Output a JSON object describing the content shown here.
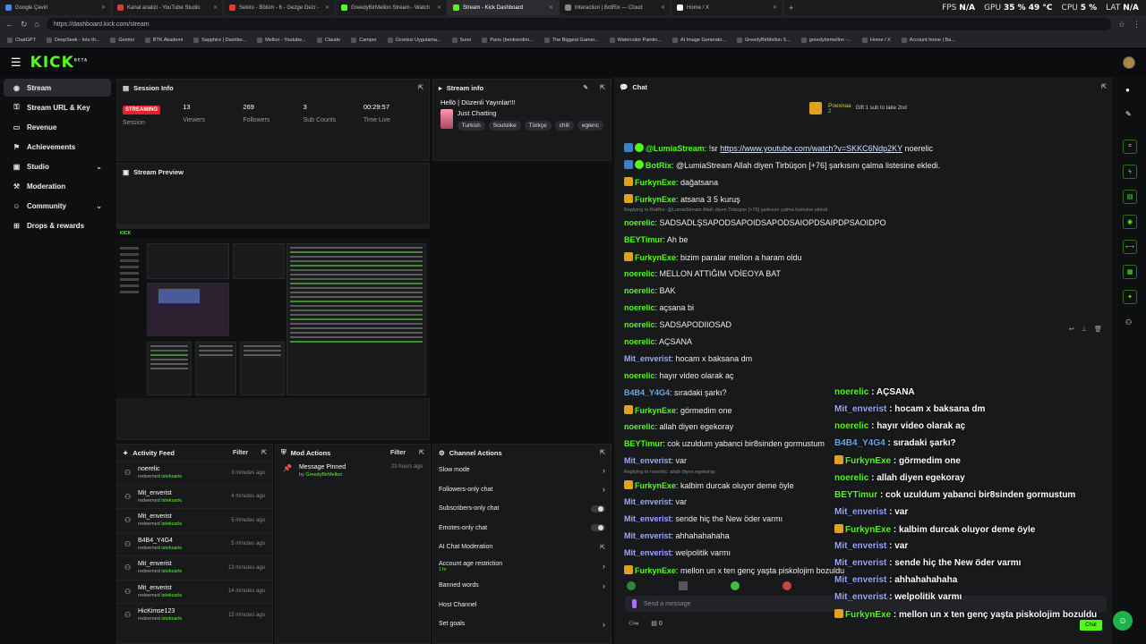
{
  "browser": {
    "tabs": [
      {
        "label": "Google Çeviri",
        "color": "#4a8af4"
      },
      {
        "label": "Kanal analizi - YouTube Studio",
        "color": "#e33"
      },
      {
        "label": "Sekiro - Bölüm - 6 - Gezge Gezr - ",
        "color": "#e33"
      },
      {
        "label": "GreedyBirMellon Stream - Watch",
        "color": "#53fc18"
      },
      {
        "label": "Stream - Kick Dashboard",
        "color": "#53fc18"
      },
      {
        "label": "Interaction | BotRix — Cloud",
        "color": "#888"
      },
      {
        "label": "Home / X",
        "color": "#fff"
      }
    ],
    "url": "https://dashboard.kick.com/stream",
    "stats": {
      "fps_label": "FPS",
      "fps": "N/A",
      "gpu_label": "GPU",
      "gpu": "35 % 49 °C",
      "cpu_label": "CPU",
      "cpu": "5 %",
      "lat_label": "LAT",
      "lat": "N/A"
    },
    "bookmarks": [
      "ChatGPT",
      "DeepSeek - Into th...",
      "Gemini",
      "BTK Akademi",
      "Sapphire | Dashbo...",
      "Mellon - Youtube...",
      "Claude",
      "Camper",
      "Ücretsiz Uygulama...",
      "Suno",
      "Pano (bentrendim...",
      "The Biggest Gamer...",
      "Watercolor Paintin...",
      "AI Image Generato...",
      "GreedyBirMellon S...",
      "greedybirmellon -...",
      "Home / X",
      "Account home | Ba..."
    ]
  },
  "brand": {
    "logo": "KICK",
    "beta": "BETA",
    "accent": "#53fc18"
  },
  "sidebar": {
    "items": [
      {
        "label": "Stream",
        "icon": "broadcast-icon",
        "glyph": "◉",
        "active": true
      },
      {
        "label": "Stream URL & Key",
        "icon": "key-icon",
        "glyph": "⚿"
      },
      {
        "label": "Revenue",
        "icon": "money-icon",
        "glyph": "▭"
      },
      {
        "label": "Achievements",
        "icon": "trophy-icon",
        "glyph": "⚑"
      },
      {
        "label": "Studio",
        "icon": "studio-icon",
        "glyph": "▣",
        "expandable": true
      },
      {
        "label": "Moderation",
        "icon": "gavel-icon",
        "glyph": "⚒"
      },
      {
        "label": "Community",
        "icon": "people-icon",
        "glyph": "☺",
        "expandable": true
      },
      {
        "label": "Drops & rewards",
        "icon": "gift-icon",
        "glyph": "⊞"
      }
    ]
  },
  "session": {
    "title": "Session Info",
    "status": "STREAMING",
    "status_label": "Session",
    "viewers": "13",
    "viewers_label": "Viewers",
    "followers": "269",
    "followers_label": "Followers",
    "subs": "3",
    "subs_label": "Sub Counts",
    "time": "00:29:57",
    "time_label": "Time Live"
  },
  "stream_info": {
    "title": "Stream info",
    "stream_title": "Hellö | Düzenli Yayınlar!!!",
    "category": "Just Chatting",
    "tags": [
      "Turkish",
      "Soulslike",
      "Türkçe",
      "chill",
      "eglenc"
    ]
  },
  "preview": {
    "title": "Stream Preview"
  },
  "activity": {
    "title": "Activity Feed",
    "filter": "Filter",
    "items": [
      {
        "user": "noerelic",
        "action": "redeemed",
        "reward": "isteksarkı",
        "time": "3 minutes ago"
      },
      {
        "user": "Mit_enverist",
        "action": "redeemed",
        "reward": "isteksarkı",
        "time": "4 minutes ago"
      },
      {
        "user": "Mit_enverist",
        "action": "redeemed",
        "reward": "isteksarkı",
        "time": "5 minutes ago"
      },
      {
        "user": "B4B4_Y4G4",
        "action": "redeemed",
        "reward": "isteksarkı",
        "time": "5 minutes ago"
      },
      {
        "user": "Mit_enverist",
        "action": "redeemed",
        "reward": "isteksarkı",
        "time": "13 minutes ago"
      },
      {
        "user": "Mit_enverist",
        "action": "redeemed",
        "reward": "isteksarkı",
        "time": "14 minutes ago"
      },
      {
        "user": "HicKimse123",
        "action": "redeemed",
        "reward": "isteksarkı",
        "time": "15 minutes ago"
      }
    ]
  },
  "mod_actions": {
    "title": "Mod Actions",
    "filter": "Filter",
    "item": {
      "label": "Message Pinned",
      "by": "by",
      "user": "GreedyBirMellon",
      "time": "23 hours ago"
    }
  },
  "channel_actions": {
    "title": "Channel Actions",
    "rows": [
      {
        "label": "Slow mode",
        "kind": "arrow"
      },
      {
        "label": "Followers-only chat",
        "kind": "arrow"
      },
      {
        "label": "Subscribers-only chat",
        "kind": "toggle"
      },
      {
        "label": "Emotes-only chat",
        "kind": "toggle"
      },
      {
        "label": "AI Chat Moderation",
        "kind": "ext"
      },
      {
        "label": "Account age restriction",
        "sub": "1 hr",
        "kind": "arrow"
      },
      {
        "label": "Banned words",
        "kind": "arrow"
      },
      {
        "label": "Host Channel",
        "kind": "none"
      },
      {
        "label": "Set goals",
        "kind": "arrow"
      }
    ]
  },
  "chat": {
    "title": "Chat",
    "top_user": "Poexnaa",
    "top_count": "2",
    "gift_hint": "Gift 1 sub to take 2nd",
    "input_placeholder": "Send a message",
    "footer_count": "0",
    "chat_button": "Chat",
    "messages": [
      {
        "user": "@LumiaStream",
        "color": "#53fc18",
        "badge": "bot",
        "text": ": !sr ",
        "link": "https://www.youtube.com/watch?v=SKKC6Ndp2KY",
        "after": " noerelic"
      },
      {
        "user": "BotRix",
        "color": "#53fc18",
        "badge": "bot",
        "text": ": @LumiaStream Allah diyen Tirbüşon [+76] şarkısını çalma listesine ekledi."
      },
      {
        "user": "FurkynExe",
        "color": "#53fc18",
        "badge": "crown",
        "text": ": dağatsana"
      },
      {
        "user": "FurkynExe",
        "color": "#53fc18",
        "badge": "crown",
        "text": ": atsana 3 5 kuruş"
      },
      {
        "reply": "Replying to BotRix: @LumiaStream Allah diyen Tirbüşon [+76] şarkısını çalma listesine ekledi."
      },
      {
        "user": "noerelic",
        "color": "#53fc18",
        "text": ": SADSADLŞSAPODSAPOIDSAPODSAIOPDSAIPDPSAOIDPO"
      },
      {
        "user": "BEYTimur",
        "color": "#53fc18",
        "text": ": Ah be"
      },
      {
        "user": "FurkynExe",
        "color": "#53fc18",
        "badge": "crown",
        "text": ": bizim paralar mellon a haram oldu"
      },
      {
        "user": "noerelic",
        "color": "#53fc18",
        "text": ": MELLON ATTIĞIM VDİEOYA BAT"
      },
      {
        "user": "noerelic",
        "color": "#53fc18",
        "text": ": BAK"
      },
      {
        "user": "noerelic",
        "color": "#53fc18",
        "text": ": açsana bi"
      },
      {
        "user": "noerelic",
        "color": "#53fc18",
        "text": ": SADSAPODIIOSAD"
      },
      {
        "user": "noerelic",
        "color": "#53fc18",
        "text": ": AÇSANA"
      },
      {
        "user": "Mit_enverist",
        "color": "#9aa7ff",
        "text": ": hocam x baksana dm"
      },
      {
        "user": "noerelic",
        "color": "#53fc18",
        "text": ": hayır video olarak aç"
      },
      {
        "user": "B4B4_Y4G4",
        "color": "#6aa7e8",
        "text": ": sıradaki şarkı?"
      },
      {
        "user": "FurkynExe",
        "color": "#53fc18",
        "badge": "crown",
        "text": ": görmedim one"
      },
      {
        "user": "noerelic",
        "color": "#53fc18",
        "text": ": allah diyen egekoray"
      },
      {
        "user": "BEYTimur",
        "color": "#53fc18",
        "text": ": cok uzuldum yabanci bir8sinden gormustum"
      },
      {
        "user": "Mit_enverist",
        "color": "#9aa7ff",
        "text": ": var"
      },
      {
        "reply": "Replying to noerelic: allah diyen egekoray"
      },
      {
        "user": "FurkynExe",
        "color": "#53fc18",
        "badge": "crown",
        "text": ": kalbim durcak oluyor deme öyle"
      },
      {
        "user": "Mit_enverist",
        "color": "#9aa7ff",
        "text": ": var"
      },
      {
        "user": "Mit_enverist",
        "color": "#9aa7ff",
        "text": ": sende hiç the New öder varmı"
      },
      {
        "user": "Mit_enverist",
        "color": "#9aa7ff",
        "text": ": ahhahahahaha"
      },
      {
        "user": "Mit_enverist",
        "color": "#9aa7ff",
        "text": ": welpolitik varmı"
      },
      {
        "user": "FurkynExe",
        "color": "#53fc18",
        "badge": "crown",
        "text": ": mellon un x ten genç yaşta piskolojim bozuldu"
      }
    ]
  },
  "overlay": {
    "messages": [
      {
        "user": "noerelic",
        "color": "#53fc18",
        "text": " : AÇSANA"
      },
      {
        "user": "Mit_enverist",
        "color": "#9aa7ff",
        "text": " : hocam x baksana dm"
      },
      {
        "user": "noerelic",
        "color": "#53fc18",
        "text": " : hayır video olarak aç"
      },
      {
        "user": "B4B4_Y4G4",
        "color": "#6aa7e8",
        "text": " : sıradaki şarkı?"
      },
      {
        "user": "FurkynExe",
        "color": "#53fc18",
        "badge": "crown",
        "text": " : görmedim one"
      },
      {
        "user": "noerelic",
        "color": "#53fc18",
        "text": " : allah diyen egekoray"
      },
      {
        "user": "BEYTimur",
        "color": "#53fc18",
        "text": " : cok uzuldum yabanci bir8sinden gormustum"
      },
      {
        "user": "Mit_enverist",
        "color": "#9aa7ff",
        "text": " : var"
      },
      {
        "user": "FurkynExe",
        "color": "#53fc18",
        "badge": "crown",
        "text": " : kalbim durcak oluyor deme öyle"
      },
      {
        "user": "Mit_enverist",
        "color": "#9aa7ff",
        "text": " : var"
      },
      {
        "user": "Mit_enverist",
        "color": "#9aa7ff",
        "text": " : sende hiç the New öder varmı"
      },
      {
        "user": "Mit_enverist",
        "color": "#9aa7ff",
        "text": " : ahhahahahaha"
      },
      {
        "user": "Mit_enverist",
        "color": "#9aa7ff",
        "text": " : welpolitik varmı"
      },
      {
        "user": "FurkynExe",
        "color": "#53fc18",
        "badge": "crown",
        "text": " : mellon un x ten genç yaşta piskolojim bozuldu"
      }
    ]
  }
}
